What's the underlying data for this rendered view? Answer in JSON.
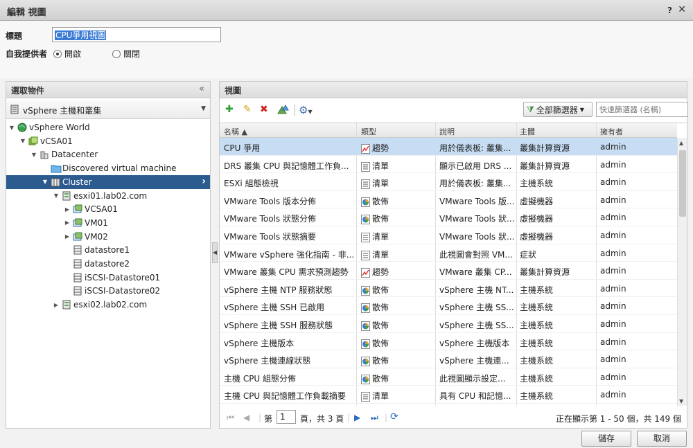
{
  "dialog": {
    "title": "編輯 視圖",
    "help": "?",
    "close": "✕"
  },
  "form": {
    "title_label": "標題",
    "title_value": "CPU爭用視圖",
    "provider_label": "自我提供者",
    "radio_on": "開啟",
    "radio_off": "關閉"
  },
  "left": {
    "header": "選取物件",
    "collapse": "«",
    "object_selector": "vSphere 主機和叢集",
    "tree": [
      {
        "label": "vSphere World",
        "icon": "world-icon",
        "twisty": "▼"
      },
      {
        "label": "vCSA01",
        "icon": "vcenter-icon",
        "twisty": "▼"
      },
      {
        "label": "Datacenter",
        "icon": "datacenter-icon",
        "twisty": "▼"
      },
      {
        "label": "Discovered virtual machine",
        "icon": "folder-icon",
        "twisty": ""
      },
      {
        "label": "Cluster",
        "icon": "cluster-icon",
        "twisty": "▼"
      },
      {
        "label": "esxi01.lab02.com",
        "icon": "host-icon",
        "twisty": "▼"
      },
      {
        "label": "VCSA01",
        "icon": "vm-icon",
        "twisty": "▶"
      },
      {
        "label": "VM01",
        "icon": "vm-icon",
        "twisty": "▶"
      },
      {
        "label": "VM02",
        "icon": "vm-icon",
        "twisty": "▶"
      },
      {
        "label": "datastore1",
        "icon": "datastore-icon",
        "twisty": ""
      },
      {
        "label": "datastore2",
        "icon": "datastore-icon",
        "twisty": ""
      },
      {
        "label": "iSCSI-Datastore01",
        "icon": "datastore-icon",
        "twisty": ""
      },
      {
        "label": "iSCSI-Datastore02",
        "icon": "datastore-icon",
        "twisty": ""
      },
      {
        "label": "esxi02.lab02.com",
        "icon": "host-icon",
        "twisty": "▶"
      }
    ]
  },
  "right": {
    "header": "視圖",
    "filter_button": "全部篩選器",
    "quick_filter_placeholder": "快速篩選器 (名稱)",
    "columns": [
      "名稱 ▲",
      "類型",
      "說明",
      "主體",
      "擁有者"
    ],
    "rows": [
      {
        "name": "CPU 爭用",
        "type": "趨勢",
        "icon": "trend-icon",
        "desc": "用於儀表板: 叢集...",
        "subject": "叢集計算資源",
        "owner": "admin"
      },
      {
        "name": "DRS 叢集 CPU 與記憶體工作負...",
        "type": "清單",
        "icon": "list-icon",
        "desc": "顯示已啟用 DRS ...",
        "subject": "叢集計算資源",
        "owner": "admin"
      },
      {
        "name": "ESXi 組態檢視",
        "type": "清單",
        "icon": "list-icon",
        "desc": "用於儀表板: 叢集...",
        "subject": "主機系統",
        "owner": "admin"
      },
      {
        "name": "VMware Tools 版本分佈",
        "type": "散佈",
        "icon": "distribution-icon",
        "desc": "VMware Tools 版...",
        "subject": "虛擬機器",
        "owner": "admin"
      },
      {
        "name": "VMware Tools 狀態分佈",
        "type": "散佈",
        "icon": "distribution-icon",
        "desc": "VMware Tools 狀...",
        "subject": "虛擬機器",
        "owner": "admin"
      },
      {
        "name": "VMware Tools 狀態摘要",
        "type": "清單",
        "icon": "list-icon",
        "desc": "VMware Tools 狀...",
        "subject": "虛擬機器",
        "owner": "admin"
      },
      {
        "name": "VMware vSphere 強化指南 - 非...",
        "type": "清單",
        "icon": "list-icon",
        "desc": "此視圖會對照 VM...",
        "subject": "症狀",
        "owner": "admin"
      },
      {
        "name": "VMware 叢集 CPU 需求預測趨勢",
        "type": "趨勢",
        "icon": "trend-icon",
        "desc": "VMware 叢集 CP...",
        "subject": "叢集計算資源",
        "owner": "admin"
      },
      {
        "name": "vSphere 主機 NTP 服務狀態",
        "type": "散佈",
        "icon": "distribution-icon",
        "desc": "vSphere 主機 NT...",
        "subject": "主機系統",
        "owner": "admin"
      },
      {
        "name": "vSphere 主機 SSH 已啟用",
        "type": "散佈",
        "icon": "distribution-icon",
        "desc": "vSphere 主機 SS...",
        "subject": "主機系統",
        "owner": "admin"
      },
      {
        "name": "vSphere 主機 SSH 服務狀態",
        "type": "散佈",
        "icon": "distribution-icon",
        "desc": "vSphere 主機 SS...",
        "subject": "主機系統",
        "owner": "admin"
      },
      {
        "name": "vSphere 主機版本",
        "type": "散佈",
        "icon": "distribution-icon",
        "desc": "vSphere 主機版本",
        "subject": "主機系統",
        "owner": "admin"
      },
      {
        "name": "vSphere 主機連線狀態",
        "type": "散佈",
        "icon": "distribution-icon",
        "desc": "vSphere 主機連...",
        "subject": "主機系統",
        "owner": "admin"
      },
      {
        "name": "主機 CPU 組態分佈",
        "type": "散佈",
        "icon": "distribution-icon",
        "desc": "此視圖顯示設定...",
        "subject": "主機系統",
        "owner": "admin"
      },
      {
        "name": "主機 CPU 與記憶體工作負載摘要",
        "type": "清單",
        "icon": "list-icon",
        "desc": "具有 CPU 和記憶...",
        "subject": "主機系統",
        "owner": "admin"
      }
    ],
    "pager": {
      "page_prefix": "第",
      "page_value": "1",
      "page_suffix": "頁，共 3 頁",
      "status": "正在顯示第 1 - 50 個，共 149 個"
    }
  },
  "buttons": {
    "save": "儲存",
    "cancel": "取消"
  }
}
